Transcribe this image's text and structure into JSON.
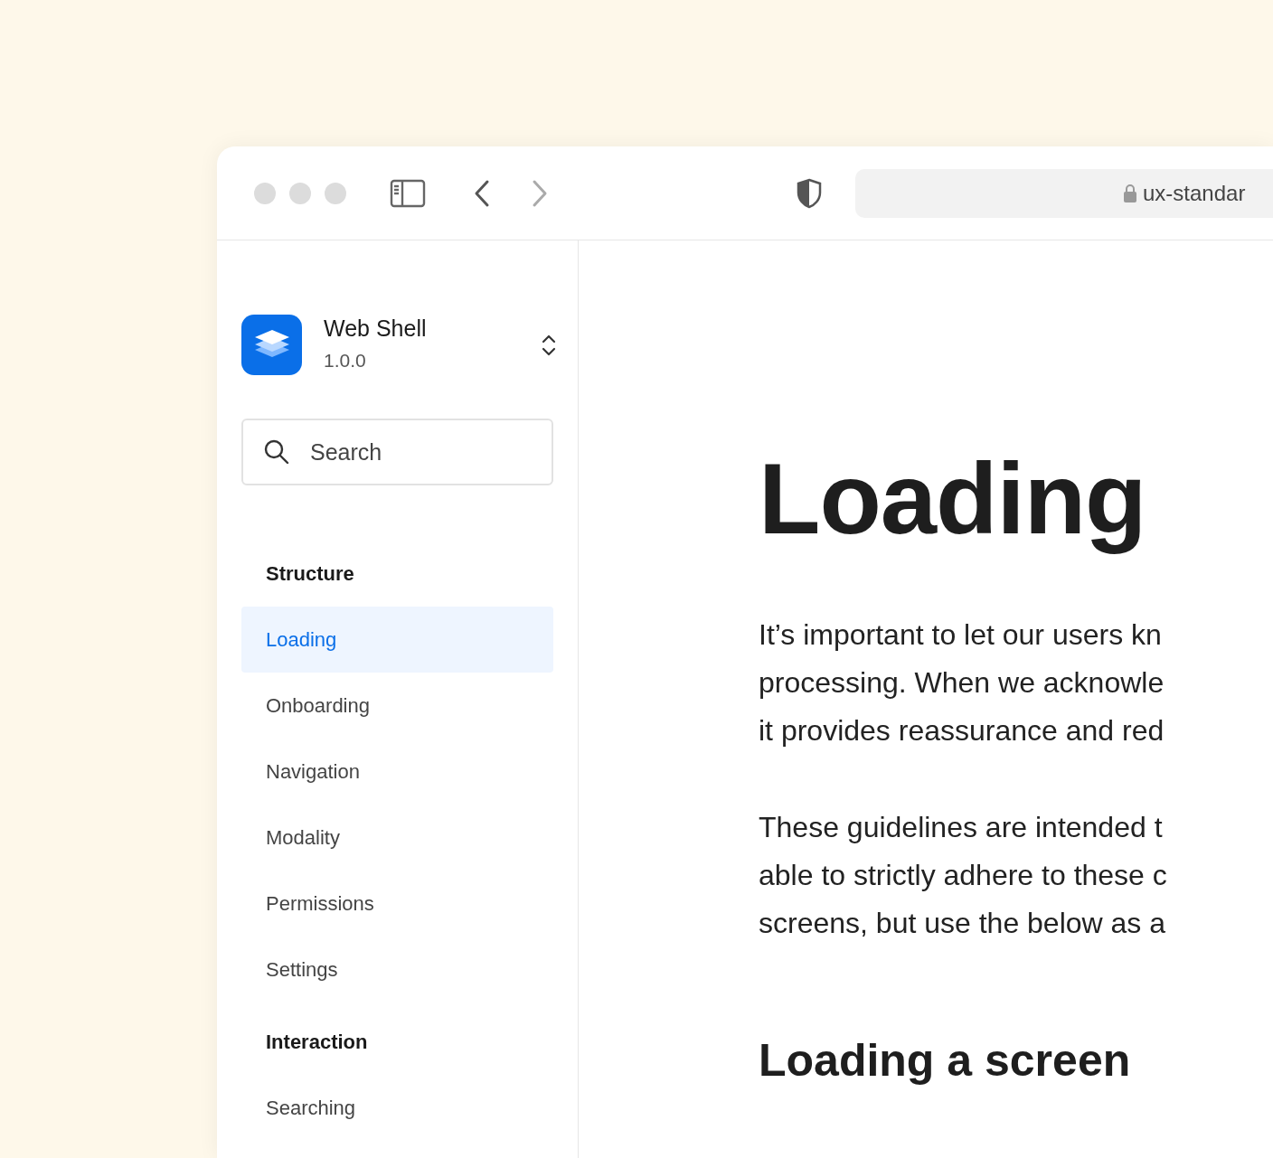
{
  "browser": {
    "url": "ux-standar"
  },
  "sidebar": {
    "app": {
      "name": "Web Shell",
      "version": "1.0.0"
    },
    "search": {
      "placeholder": "Search"
    },
    "sections": [
      {
        "title": "Structure",
        "items": [
          {
            "label": "Loading",
            "selected": true
          },
          {
            "label": "Onboarding",
            "selected": false
          },
          {
            "label": "Navigation",
            "selected": false
          },
          {
            "label": "Modality",
            "selected": false
          },
          {
            "label": "Permissions",
            "selected": false
          },
          {
            "label": "Settings",
            "selected": false
          }
        ]
      },
      {
        "title": "Interaction",
        "items": [
          {
            "label": "Searching",
            "selected": false
          }
        ]
      }
    ]
  },
  "content": {
    "title": "Loading",
    "paragraphs": [
      [
        "It’s important to let our users kn",
        "processing. When we acknowle",
        "it provides reassurance and red"
      ],
      [
        "These guidelines are intended t",
        "able to strictly adhere to these c",
        "screens, but use the below as a"
      ]
    ],
    "subheading": "Loading a screen"
  }
}
